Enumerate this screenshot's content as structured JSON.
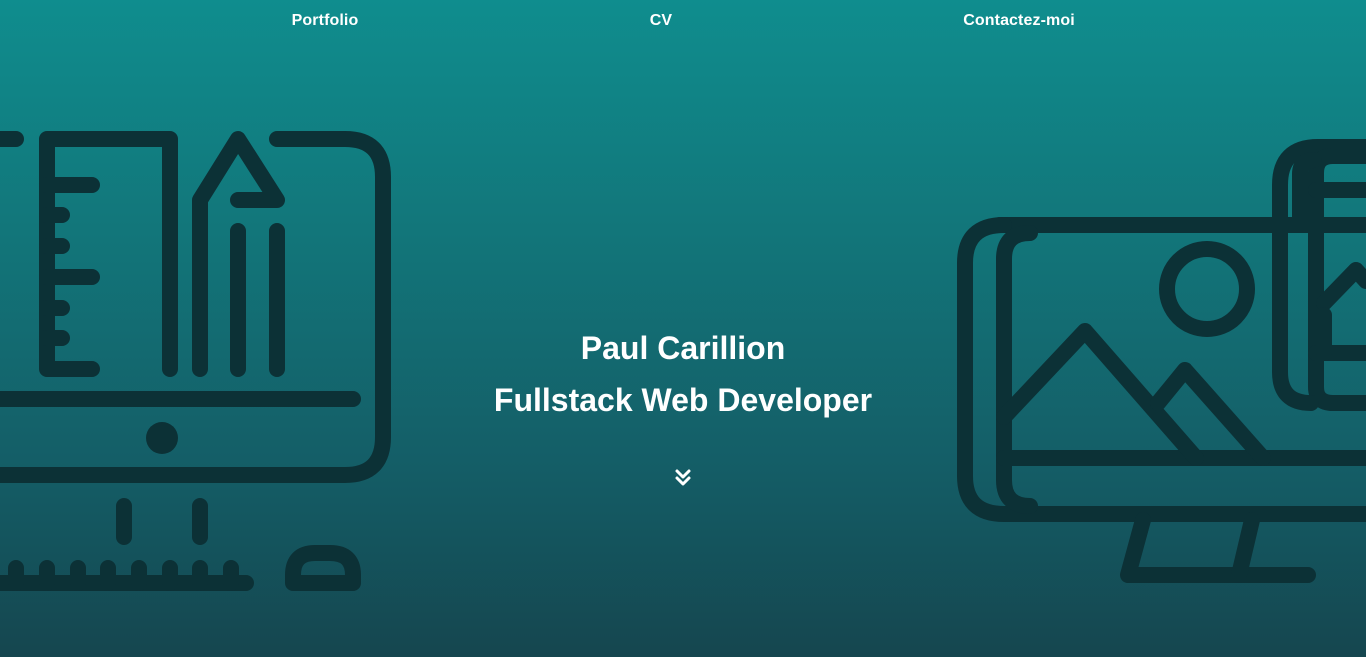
{
  "nav": {
    "items": [
      {
        "label": "Portfolio"
      },
      {
        "label": "CV"
      },
      {
        "label": "Contactez-moi"
      }
    ]
  },
  "hero": {
    "name": "Paul Carillion",
    "title": "Fullstack Web Developer"
  },
  "icons": {
    "left_illustration": "design-monitor-icon",
    "right_illustration": "image-gallery-monitor-icon",
    "scroll": "chevron-double-down-icon"
  },
  "colors": {
    "gradient_top": "#0f8d8e",
    "gradient_bottom": "#15464f",
    "illustration_stroke": "#0c3136",
    "text": "#ffffff"
  }
}
